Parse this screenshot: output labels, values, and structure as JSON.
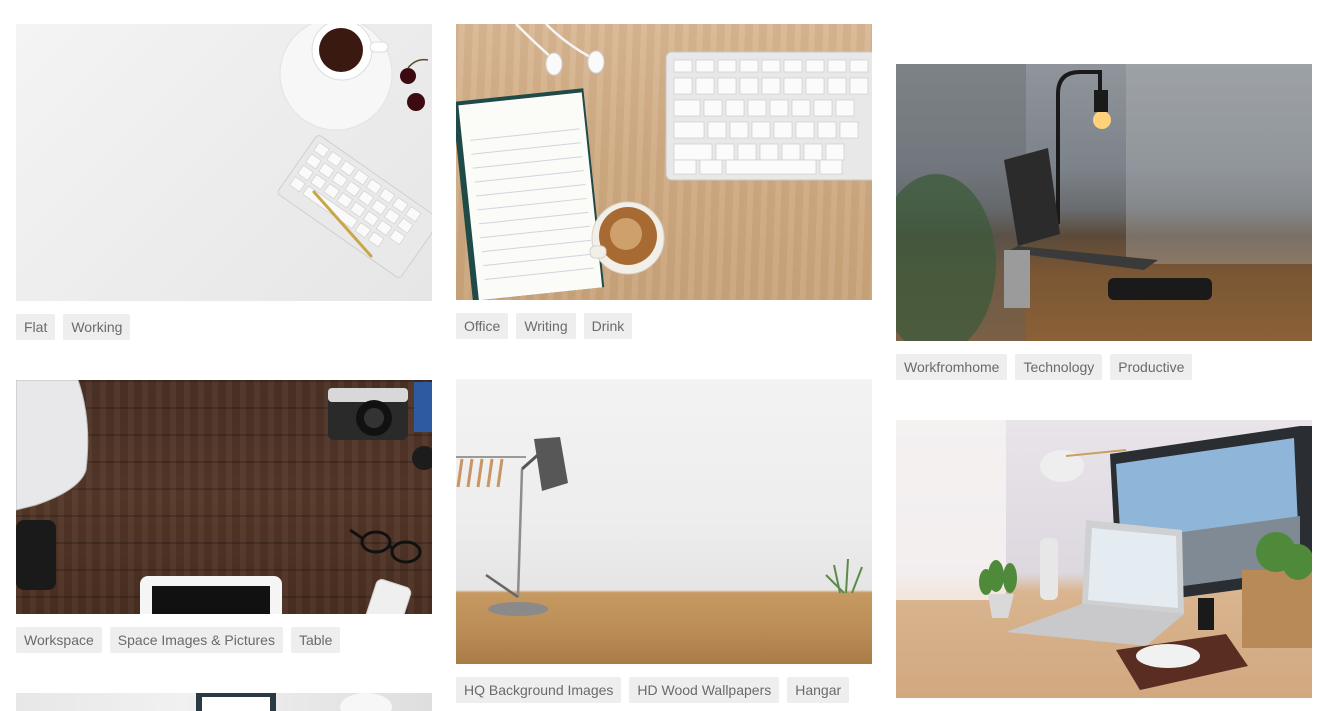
{
  "gallery": {
    "cards": [
      {
        "name": "flat-working-photo",
        "tags": [
          "Flat",
          "Working"
        ]
      },
      {
        "name": "office-writing-photo",
        "tags": [
          "Office",
          "Writing",
          "Drink"
        ]
      },
      {
        "name": "workfromhome-photo",
        "tags": [
          "Workfromhome",
          "Technology",
          "Productive"
        ]
      },
      {
        "name": "workspace-table-photo",
        "tags": [
          "Workspace",
          "Space Images & Pictures",
          "Table"
        ]
      },
      {
        "name": "wood-background-photo",
        "tags": [
          "HQ Background Images",
          "HD Wood Wallpapers",
          "Hangar"
        ]
      },
      {
        "name": "desk-setup-photo",
        "tags": []
      },
      {
        "name": "partial-photo",
        "tags": []
      }
    ]
  },
  "colors": {
    "tag_background": "#eeeeee",
    "tag_text": "#6a6a6a",
    "page_background": "#ffffff"
  }
}
